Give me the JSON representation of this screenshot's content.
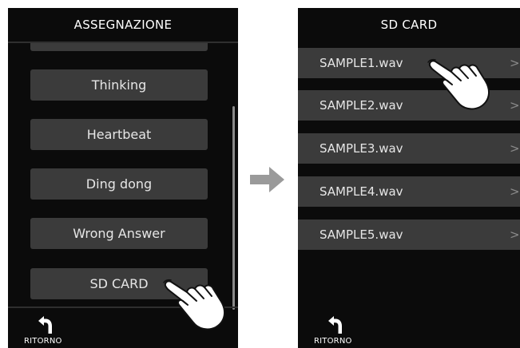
{
  "left_screen": {
    "title": "ASSEGNAZIONE",
    "items": [
      "Thinking",
      "Heartbeat",
      "Ding dong",
      "Wrong Answer",
      "SD CARD"
    ],
    "back_label": "RITORNO"
  },
  "right_screen": {
    "title": "SD CARD",
    "files": [
      "SAMPLE1.wav",
      "SAMPLE2.wav",
      "SAMPLE3.wav",
      "SAMPLE4.wav",
      "SAMPLE5.wav"
    ],
    "chevron": ">",
    "back_label": "RITORNO"
  },
  "icons": {
    "transition": "right-arrow-icon",
    "tap": "pointing-hand-icon",
    "back": "return-arrow-icon"
  },
  "colors": {
    "screen_bg": "#0b0b0b",
    "button_bg": "#3b3b3b",
    "arrow": "#9a9a9a"
  }
}
